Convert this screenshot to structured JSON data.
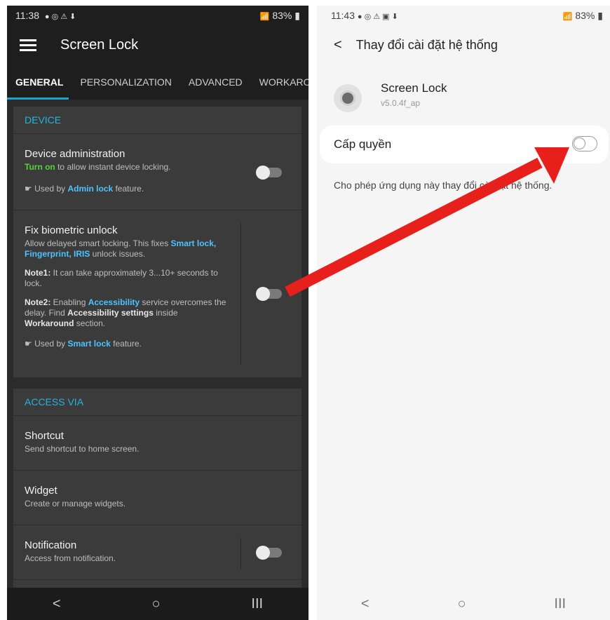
{
  "left": {
    "status": {
      "time": "11:38",
      "battery": "83%"
    },
    "app_title": "Screen Lock",
    "tabs": [
      "GENERAL",
      "PERSONALIZATION",
      "ADVANCED",
      "WORKARO"
    ],
    "device": {
      "header": "DEVICE",
      "admin": {
        "title": "Device administration",
        "turn_on": "Turn on",
        "sub_rest": " to allow instant device locking.",
        "used_prefix": "☛ Used by ",
        "used_feature": "Admin lock",
        "used_suffix": " feature."
      },
      "bio": {
        "title": "Fix biometric unlock",
        "l1_a": "Allow delayed smart locking. This fixes ",
        "l1_b": "Smart lock, Fingerprint, IRIS",
        "l1_c": " unlock issues.",
        "n1_a": "Note1:",
        "n1_b": " It can take approximately 3...10+ seconds to lock.",
        "n2_a": "Note2:",
        "n2_b": " Enabling ",
        "n2_c": "Accessibility",
        "n2_d": " service overcomes the delay. Find ",
        "n2_e": "Accessibility settings",
        "n2_f": " inside ",
        "n2_g": "Workaround",
        "n2_h": " section.",
        "used_prefix": "☛ Used by ",
        "used_feature": "Smart lock",
        "used_suffix": " feature."
      }
    },
    "access": {
      "header": "ACCESS VIA",
      "items": [
        {
          "title": "Shortcut",
          "sub": "Send shortcut to home screen."
        },
        {
          "title": "Widget",
          "sub": "Create or manage widgets."
        },
        {
          "title": "Notification",
          "sub": "Access from notification."
        }
      ]
    },
    "nav": [
      "<",
      "○",
      "III"
    ]
  },
  "right": {
    "status": {
      "time": "11:43",
      "battery": "83%"
    },
    "header": "Thay đổi cài đặt hệ thống",
    "app_name": "Screen Lock",
    "app_version": "v5.0.4f_ap",
    "perm_label": "Cấp quyền",
    "desc": "Cho phép ứng dụng này thay đổi cài đặt hệ thống.",
    "nav": [
      "<",
      "○",
      "III"
    ]
  },
  "colors": {
    "accent_blue": "#25b4dd",
    "arrow_red": "#e8201c",
    "green": "#57d33b"
  }
}
